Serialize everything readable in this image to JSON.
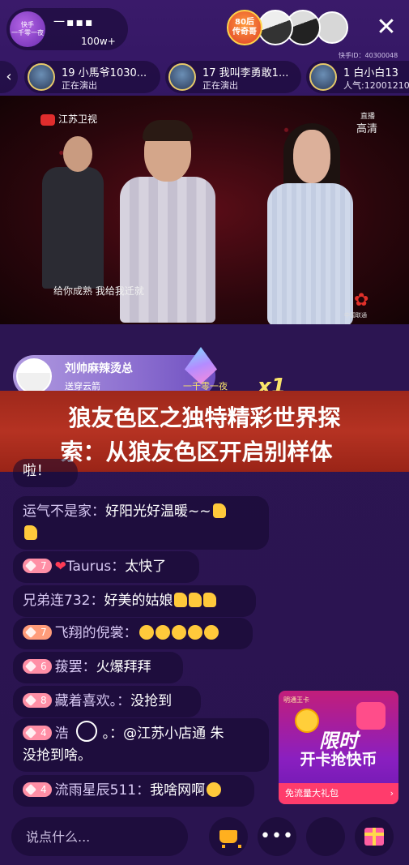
{
  "header": {
    "host_avatar_line1": "快手",
    "host_avatar_line2": "一千零一夜",
    "host_name": "一▪▪▪",
    "host_fans": "100w+",
    "rank_badge_line1": "80后",
    "rank_badge_line2": "传奇哥",
    "close_label": "✕"
  },
  "pk_bar": {
    "prev_arrow": "‹",
    "kuaishou_id": "快手ID：40300048",
    "cards": [
      {
        "name": "19 小馬爷1030...",
        "status": "正在演出"
      },
      {
        "name": "17 我叫李勇敢1...",
        "status": "正在演出"
      },
      {
        "name": "1 白小白13",
        "status": "人气:12001210"
      }
    ]
  },
  "video": {
    "channel_logo": "江苏卫视",
    "live_tag": "直播",
    "quality": "高清",
    "subtitle": "给你成熟 我给我迁就",
    "sponsor": "中国联通"
  },
  "gift": {
    "sender": "刘帅麻辣烫总",
    "action": "送穿云箭",
    "brand": "一千零一夜",
    "count": "x1"
  },
  "headline": {
    "line1": "狼友色区之独特精彩世界探",
    "line2": "索：从狼友色区开启别样体"
  },
  "chat": [
    {
      "user": "",
      "text": "啦！"
    },
    {
      "user": "运气不是家：",
      "text": "好阳光好温暖~~"
    },
    {
      "level": "7",
      "user": "Taurus：",
      "text": "太快了"
    },
    {
      "user": "兄弟连732：",
      "text": "好美的姑娘"
    },
    {
      "level": "7",
      "user": "飞翔的倪裳：",
      "text": ""
    },
    {
      "level": "6",
      "user": "菝罢：",
      "text": "火爆拜拜"
    },
    {
      "level": "8",
      "user": "藏着喜欢。：",
      "text": "没抢到"
    },
    {
      "level": "4",
      "user": "浩",
      "text": "。：@江苏小店通 朱",
      "text2": "没抢到啥。"
    },
    {
      "level": "4",
      "user": "流雨星辰511：",
      "text": "我啥网啊"
    }
  ],
  "ad": {
    "top_text": "明通王卡",
    "line1": "限时",
    "line2": "开卡抢快币",
    "button": "免流量大礼包",
    "button_arrow": "›"
  },
  "bottom": {
    "input_placeholder": "说点什么..."
  }
}
